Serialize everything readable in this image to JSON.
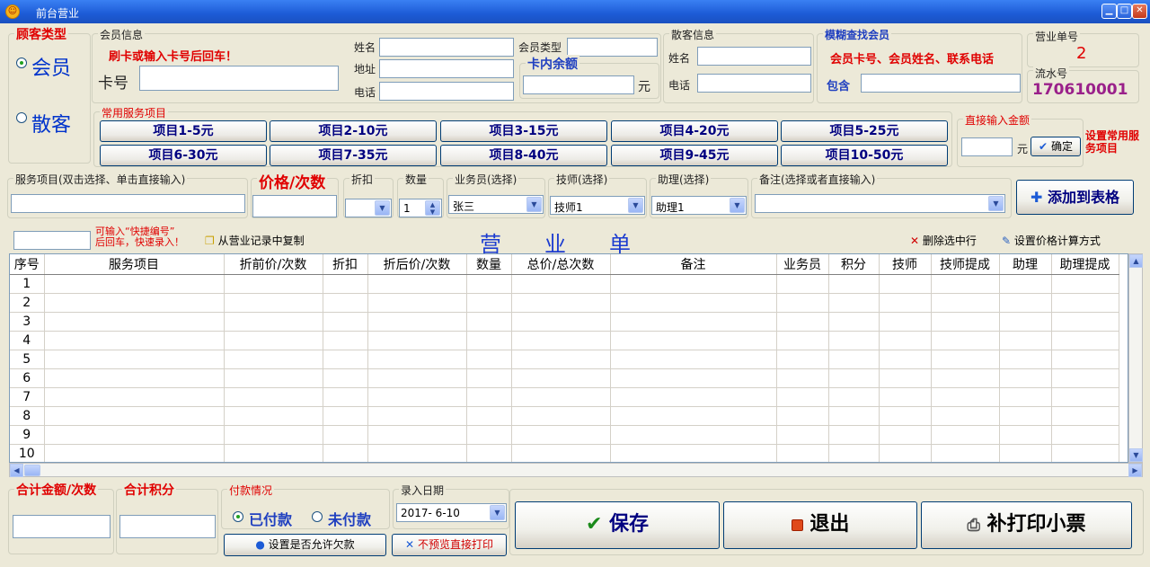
{
  "window": {
    "title": "前台营业"
  },
  "customer_type": {
    "legend": "顾客类型",
    "member": "会员",
    "walkin": "散客"
  },
  "member_info": {
    "legend": "会员信息",
    "hint": "刷卡或输入卡号后回车！",
    "card_label": "卡号",
    "name_label": "姓名",
    "address_label": "地址",
    "phone_label": "电话",
    "type_label": "会员类型",
    "balance_legend": "卡内余额",
    "yuan": "元"
  },
  "walkin_info": {
    "legend": "散客信息",
    "name_label": "姓名",
    "phone_label": "电话"
  },
  "fuzzy": {
    "legend": "模糊查找会员",
    "hint": "会员卡号、会员姓名、联系电话",
    "contains_label": "包含"
  },
  "bill": {
    "legend": "营业单号",
    "number": "2",
    "serial_legend": "流水号",
    "serial": "170610001"
  },
  "services": {
    "legend": "常用服务项目",
    "items": [
      "项目1-5元",
      "项目2-10元",
      "项目3-15元",
      "项目4-20元",
      "项目5-25元",
      "项目6-30元",
      "项目7-35元",
      "项目8-40元",
      "项目9-45元",
      "项目10-50元"
    ]
  },
  "direct": {
    "legend": "直接输入金额",
    "yuan": "元",
    "confirm": "确定",
    "setup_link": "设置常用服务项目"
  },
  "entry": {
    "service_legend": "服务项目(双击选择、单击直接输入)",
    "price_legend": "价格/次数",
    "discount_legend": "折扣",
    "qty_legend": "数量",
    "qty_value": "1",
    "salesman_legend": "业务员(选择)",
    "salesman_value": "张三",
    "tech_legend": "技师(选择)",
    "tech_value": "技师1",
    "assistant_legend": "助理(选择)",
    "assistant_value": "助理1",
    "remark_legend": "备注(选择或者直接输入)",
    "add_button": "添加到表格"
  },
  "toolbar": {
    "quick_hint_1": "可输入“快捷编号”",
    "quick_hint_2": "后回车，快速录入！",
    "copy_label": "从营业记录中复制",
    "sheet_title": "营　　业　　单",
    "delete_label": "删除选中行",
    "price_mode_label": "设置价格计算方式"
  },
  "table": {
    "columns": [
      "序号",
      "服务项目",
      "折前价/次数",
      "折扣",
      "折后价/次数",
      "数量",
      "总价/总次数",
      "备注",
      "业务员",
      "积分",
      "技师",
      "技师提成",
      "助理",
      "助理提成"
    ],
    "rows": [
      "1",
      "2",
      "3",
      "4",
      "5",
      "6",
      "7",
      "8",
      "9",
      "10"
    ]
  },
  "footer": {
    "total_legend": "合计金额/次数",
    "points_legend": "合计积分",
    "payment_legend": "付款情况",
    "paid": "已付款",
    "unpaid": "未付款",
    "allow_debt": "设置是否允许欠款",
    "no_preview": "不预览直接打印",
    "date_legend": "录入日期",
    "date_value": "2017- 6-10",
    "save": "保存",
    "exit": "退出",
    "reprint": "补打印小票"
  }
}
